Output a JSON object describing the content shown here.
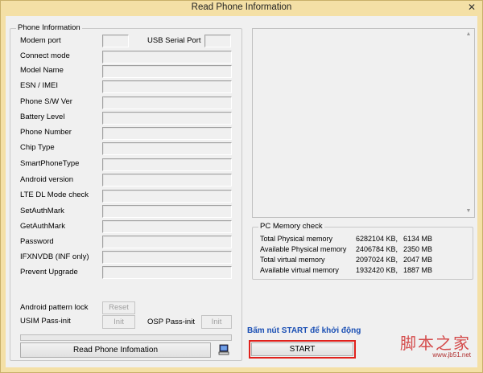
{
  "window": {
    "title": "Read Phone Information",
    "close_glyph": "✕"
  },
  "phone_info": {
    "group_title": "Phone Information",
    "modem_port_label": "Modem port",
    "usb_serial_port_label": "USB Serial Port",
    "modem_port_value": "",
    "usb_serial_port_value": "",
    "rows": [
      {
        "label": "Connect mode",
        "value": ""
      },
      {
        "label": "Model Name",
        "value": ""
      },
      {
        "label": "ESN / IMEI",
        "value": ""
      },
      {
        "label": "Phone S/W Ver",
        "value": ""
      },
      {
        "label": "Battery Level",
        "value": ""
      },
      {
        "label": "Phone Number",
        "value": ""
      },
      {
        "label": "Chip Type",
        "value": ""
      },
      {
        "label": "SmartPhoneType",
        "value": ""
      },
      {
        "label": "Android version",
        "value": ""
      },
      {
        "label": "LTE DL Mode check",
        "value": ""
      },
      {
        "label": "SetAuthMark",
        "value": ""
      },
      {
        "label": "GetAuthMark",
        "value": ""
      },
      {
        "label": "Password",
        "value": ""
      },
      {
        "label": "IFXNVDB (INF only)",
        "value": ""
      },
      {
        "label": "Prevent Upgrade",
        "value": ""
      }
    ],
    "android_pattern_lock_label": "Android pattern lock",
    "reset_label": "Reset",
    "usim_pass_init_label": "USIM Pass-init",
    "init_label": "Init",
    "osp_pass_init_label": "OSP Pass-init",
    "osp_init_label": "Init"
  },
  "buttons": {
    "read_phone_information": "Read Phone Infomation",
    "start": "START",
    "pc_icon": "computer-icon"
  },
  "pc_memory": {
    "group_title": "PC Memory check",
    "rows": [
      {
        "label": "Total Physical memory",
        "kb": "6282104 KB,",
        "mb": "6134 MB"
      },
      {
        "label": "Available Physical memory",
        "kb": "2406784 KB,",
        "mb": "2350 MB"
      },
      {
        "label": "Total virtual memory",
        "kb": "2097024 KB,",
        "mb": "2047 MB"
      },
      {
        "label": "Available virtual memory",
        "kb": "1932420 KB,",
        "mb": "1887 MB"
      }
    ]
  },
  "annotation": "Bấm nút START để khởi động",
  "watermark": {
    "main": "脚本之家",
    "sub": "www.jb51.net"
  },
  "colors": {
    "title_bar": "#f4e0a6",
    "highlight": "#e0211c",
    "annotation": "#1a4fb4"
  }
}
